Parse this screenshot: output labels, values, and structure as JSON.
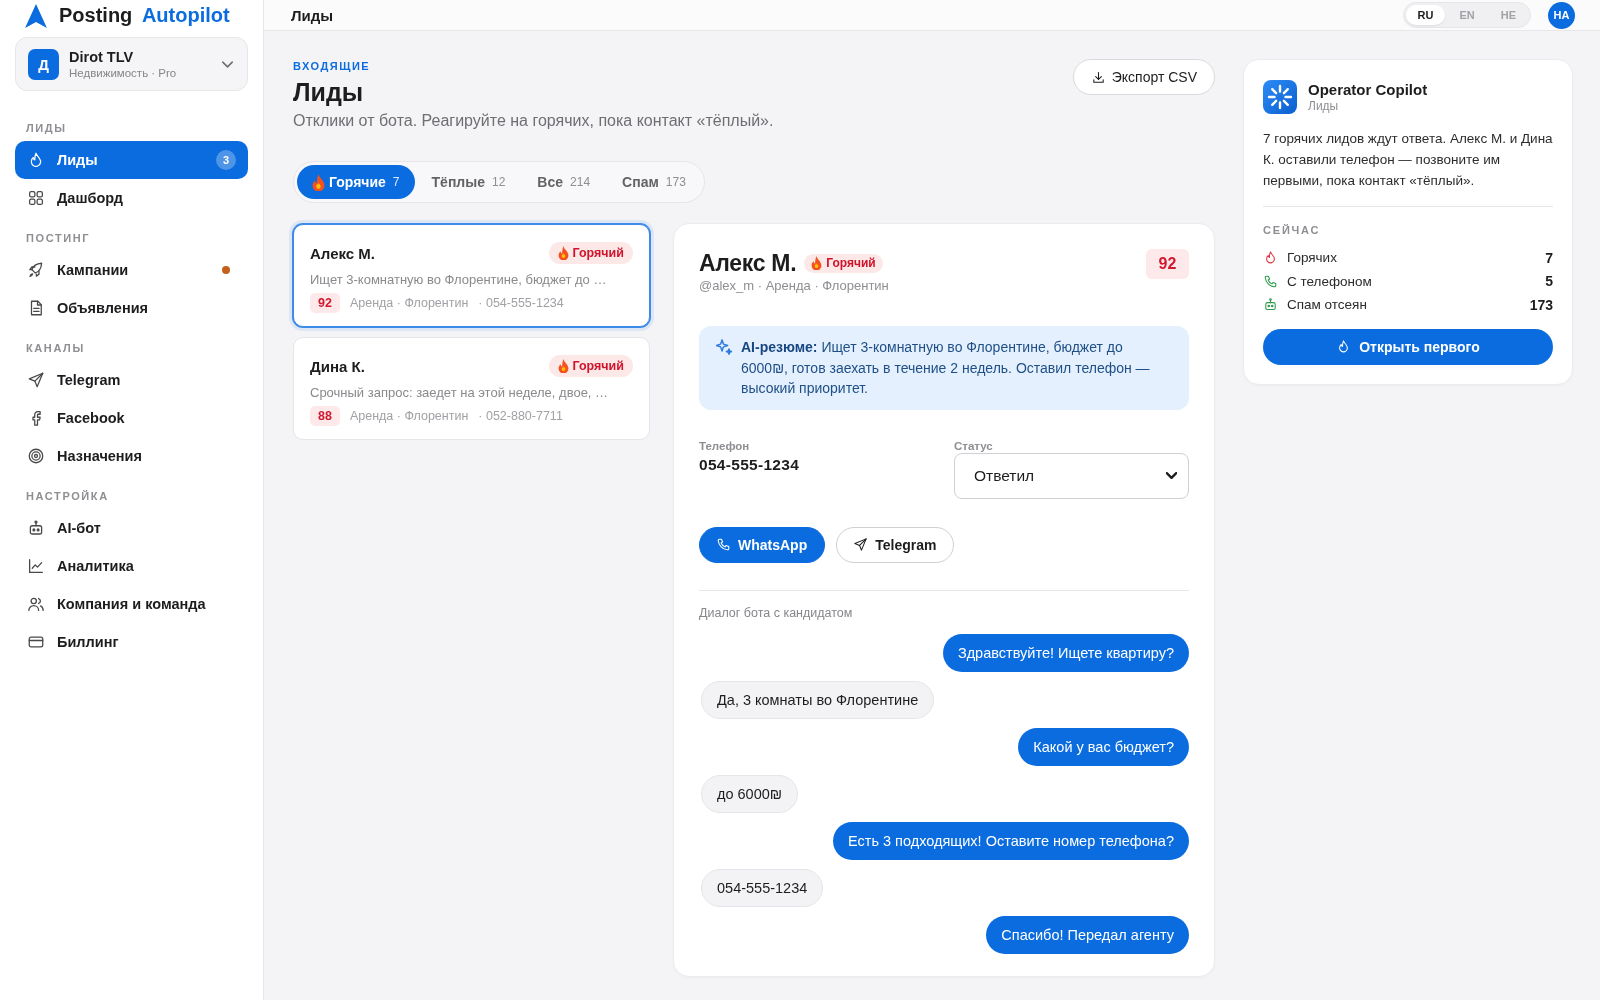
{
  "sidebar": {
    "logo": {
      "name": "Posting",
      "accent": "Autopilot"
    },
    "workspace": {
      "initial": "Д",
      "name": "Dirot TLV",
      "plan": "Недвижимость · Pro"
    },
    "sections": [
      {
        "title": "ЛИДЫ",
        "items": [
          {
            "label": "Лиды",
            "selected": true,
            "badge": "3",
            "dot": false
          },
          {
            "label": "Дашборд",
            "selected": false,
            "dot": false
          }
        ]
      },
      {
        "title": "ПОСТИНГ",
        "items": [
          {
            "label": "Кампании",
            "selected": false,
            "dot": true
          },
          {
            "label": "Объявления",
            "selected": false,
            "dot": false
          }
        ]
      },
      {
        "title": "КАНАЛЫ",
        "items": [
          {
            "label": "Telegram",
            "selected": false,
            "dot": false
          },
          {
            "label": "Facebook",
            "selected": false,
            "dot": false
          },
          {
            "label": "Назначения",
            "selected": false,
            "dot": false
          }
        ]
      },
      {
        "title": "НАСТРОЙКА",
        "items": [
          {
            "label": "AI-бот",
            "selected": false,
            "dot": false
          },
          {
            "label": "Аналитика",
            "selected": false,
            "dot": false
          },
          {
            "label": "Компания и команда",
            "selected": false,
            "dot": false
          },
          {
            "label": "Биллинг",
            "selected": false,
            "dot": false
          }
        ]
      }
    ]
  },
  "topbar": {
    "title": "Лиды",
    "languages": [
      {
        "label": "RU",
        "selected": true
      },
      {
        "label": "EN",
        "selected": false
      },
      {
        "label": "HE",
        "selected": false
      }
    ],
    "avatar": "HA"
  },
  "header": {
    "eyebrow": "ВХОДЯЩИЕ",
    "title": "Лиды",
    "subtitle": "Отклики от бота. Реагируйте на горячих, пока контакт «тёплый».",
    "export_button": "Экспорт CSV"
  },
  "tabs": [
    {
      "label": "Горячие",
      "count": "7",
      "selected": true
    },
    {
      "label": "Тёплые",
      "count": "12",
      "selected": false
    },
    {
      "label": "Все",
      "count": "214",
      "selected": false
    },
    {
      "label": "Спам",
      "count": "173",
      "selected": false
    }
  ],
  "leads": [
    {
      "name": "Алекс М.",
      "tag": {
        "kind": "hot",
        "label": "Горячий"
      },
      "preview": "Ищет 3-комнатную во Флорентине, бюджет до …",
      "score": "92",
      "meta": "Аренда · Флорентин",
      "phone": "· 054-555-1234",
      "selected": true
    },
    {
      "name": "Дина К.",
      "tag": {
        "kind": "hot",
        "label": "Горячий"
      },
      "preview": "Срочный запрос: заедет на этой неделе, двое, …",
      "score": "88",
      "meta": "Аренда · Флорентин",
      "phone": "· 052-880-7711",
      "selected": false
    }
  ],
  "detail": {
    "name": "Алекс М.",
    "tag": {
      "kind": "hot",
      "label": "Горячий"
    },
    "handle": "@alex_m · Аренда · Флорентин",
    "score": "92",
    "summary": "**AI-резюме:** Ищет 3-комнатную во Флорентине, бюджет до 6000₪, готов заехать в течение 2 недель. Оставил телефон — высокий приоритет.",
    "phone_label": "Телефон",
    "phone": "054-555-1234",
    "status_label": "Статус",
    "status": "Ответил",
    "actions": [
      {
        "kind": "primary",
        "label": "WhatsApp"
      },
      {
        "kind": "outline",
        "label": "Telegram"
      }
    ],
    "chat_title": "Диалог бота с кандидатом",
    "messages": [
      {
        "kind": "bot",
        "text": "Здравствуйте! Ищете квартиру?"
      },
      {
        "kind": "candidate",
        "text": "Да, 3 комнаты во Флорентине"
      },
      {
        "kind": "bot",
        "text": "Какой у вас бюджет?"
      },
      {
        "kind": "candidate",
        "text": "до 6000₪"
      },
      {
        "kind": "bot",
        "text": "Есть 3 подходящих! Оставите номер телефона?"
      },
      {
        "kind": "candidate",
        "text": "054-555-1234"
      },
      {
        "kind": "bot",
        "text": "Спасибо! Передал агенту"
      }
    ]
  },
  "copilot": {
    "title": "Operator Copilot",
    "subtitle": "Лиды",
    "message": "7 горячих лидов ждут ответа. Алекс М. и Дина К. оставили телефон — позвоните им первыми, пока контакт «тёплый».",
    "section": "СЕЙЧАС",
    "stats": [
      {
        "label": "Горячих",
        "value": "7"
      },
      {
        "label": "С телефоном",
        "value": "5"
      },
      {
        "label": "Спам отсеян",
        "value": "173"
      }
    ],
    "button": "Открыть первого"
  }
}
